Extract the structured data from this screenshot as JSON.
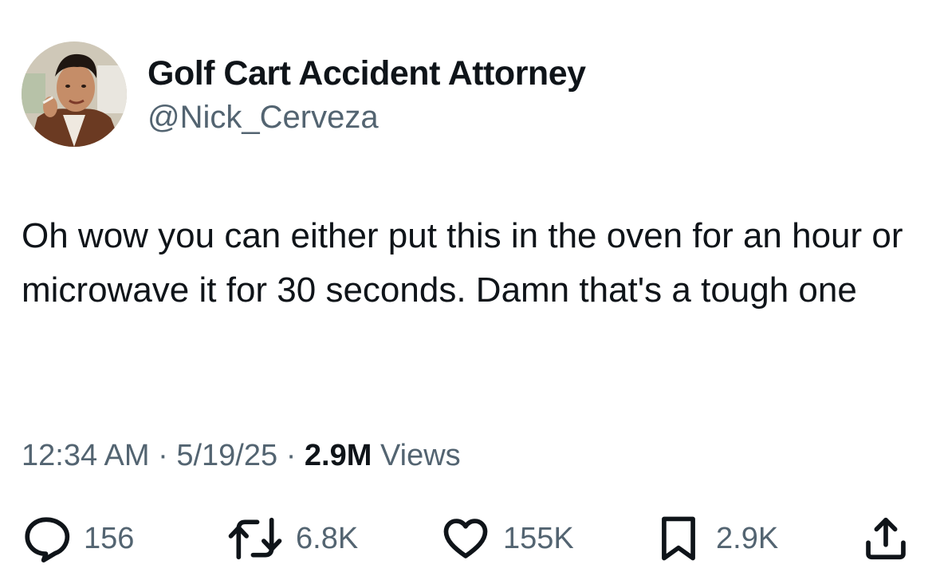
{
  "author": {
    "display_name": "Golf Cart Accident Attorney",
    "handle": "@Nick_Cerveza"
  },
  "tweet": {
    "text": "Oh wow you can either put this in the oven for an hour or microwave it for 30 seconds. Damn that's a tough one"
  },
  "meta": {
    "time": "12:34 AM",
    "separator": " · ",
    "date": "5/19/25",
    "views_count": "2.9M",
    "views_label": " Views"
  },
  "actions": {
    "replies": {
      "icon": "reply-icon",
      "count": "156"
    },
    "reposts": {
      "icon": "repost-icon",
      "count": "6.8K"
    },
    "likes": {
      "icon": "heart-icon",
      "count": "155K"
    },
    "bookmarks": {
      "icon": "bookmark-icon",
      "count": "2.9K"
    },
    "share": {
      "icon": "share-icon"
    }
  },
  "colors": {
    "text_primary": "#0f1419",
    "text_secondary": "#536471",
    "background": "#ffffff"
  }
}
